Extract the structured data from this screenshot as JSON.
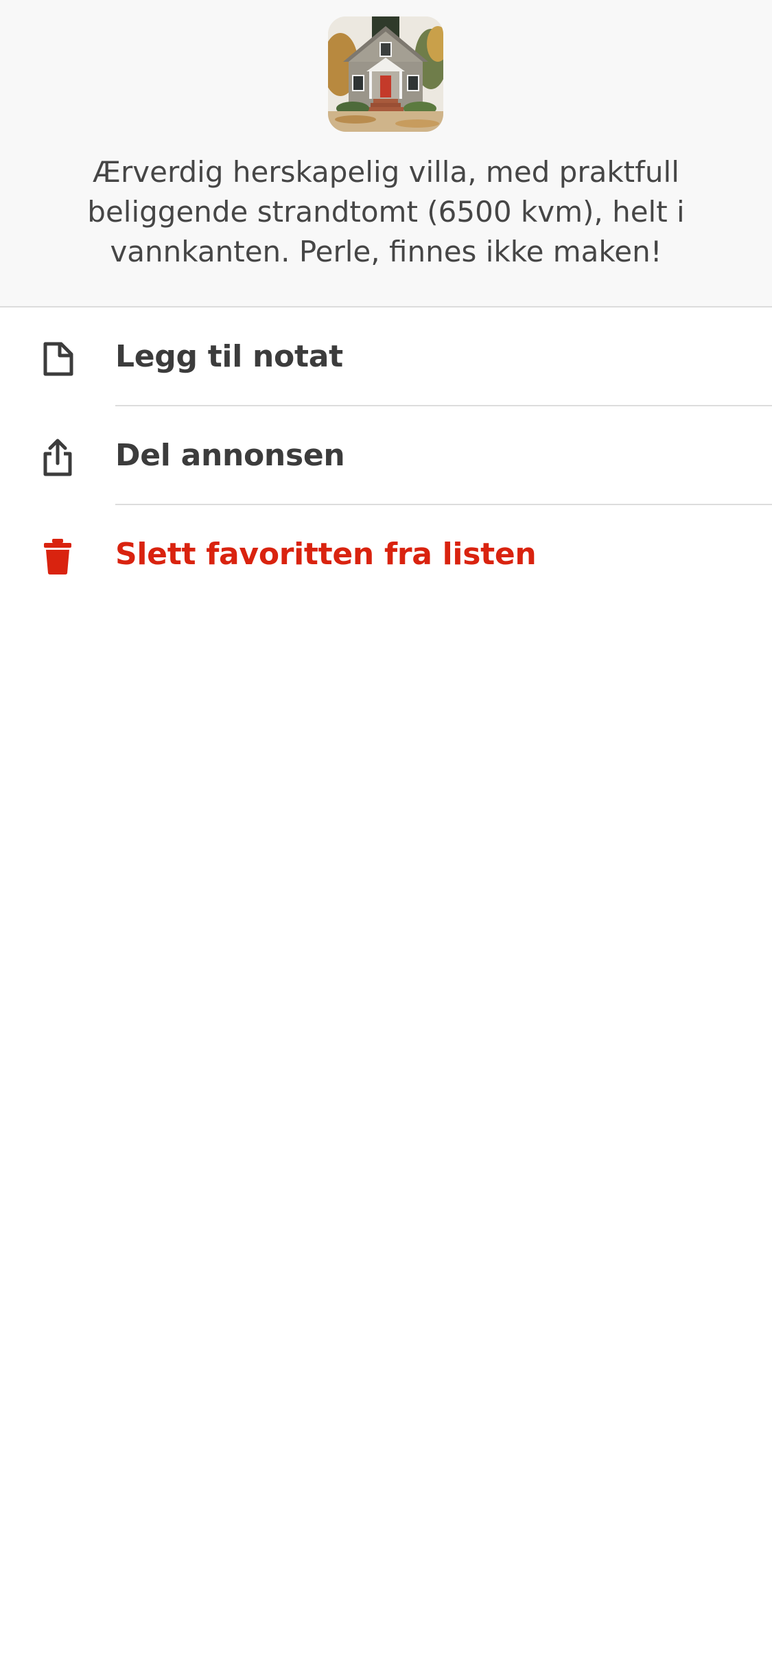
{
  "listing": {
    "thumbnail": "house-thumbnail",
    "title": "Ærverdig herskapelig villa, med praktfull beliggende strandtomt (6500 kvm), helt i vannkanten. Perle, finnes ikke maken!"
  },
  "menu": {
    "items": [
      {
        "label": "Legg til notat",
        "icon": "note-icon"
      },
      {
        "label": "Del annonsen",
        "icon": "share-icon"
      },
      {
        "label": "Slett favoritten fra listen",
        "icon": "trash-icon"
      }
    ]
  },
  "colors": {
    "header_background": "#f8f8f8",
    "text": "#3c3c3c",
    "danger": "#d9230f",
    "divider": "#dcdcdc"
  }
}
